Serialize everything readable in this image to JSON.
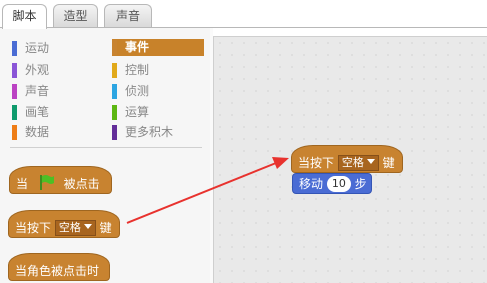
{
  "tabs": [
    {
      "label": "脚本",
      "active": true
    },
    {
      "label": "造型",
      "active": false
    },
    {
      "label": "声音",
      "active": false
    }
  ],
  "categories": [
    {
      "label": "运动",
      "color": "#4a6cd4"
    },
    {
      "label": "外观",
      "color": "#8a55d7"
    },
    {
      "label": "声音",
      "color": "#bb42c3"
    },
    {
      "label": "画笔",
      "color": "#0e9a6c"
    },
    {
      "label": "数据",
      "color": "#ee7d16"
    },
    {
      "label": "事件",
      "color": "#c88330",
      "selected": true
    },
    {
      "label": "控制",
      "color": "#e1a91a"
    },
    {
      "label": "侦测",
      "color": "#2ca5e2"
    },
    {
      "label": "运算",
      "color": "#5cb712"
    },
    {
      "label": "更多积木",
      "color": "#632d99"
    }
  ],
  "palette": {
    "flag_block": {
      "prefix": "当",
      "suffix": "被点击",
      "icon": "green-flag-icon"
    },
    "key_block": {
      "prefix": "当按下",
      "key": "空格",
      "suffix": "键"
    },
    "sprite_block": {
      "label": "当角色被点击时"
    }
  },
  "script": {
    "hat": {
      "prefix": "当按下",
      "key": "空格",
      "suffix": "键"
    },
    "move": {
      "label": "移动",
      "steps": "10",
      "unit": "步"
    }
  },
  "colors": {
    "events": "#c88330",
    "motion": "#4a6cd4",
    "arrow": "#e8322e"
  }
}
